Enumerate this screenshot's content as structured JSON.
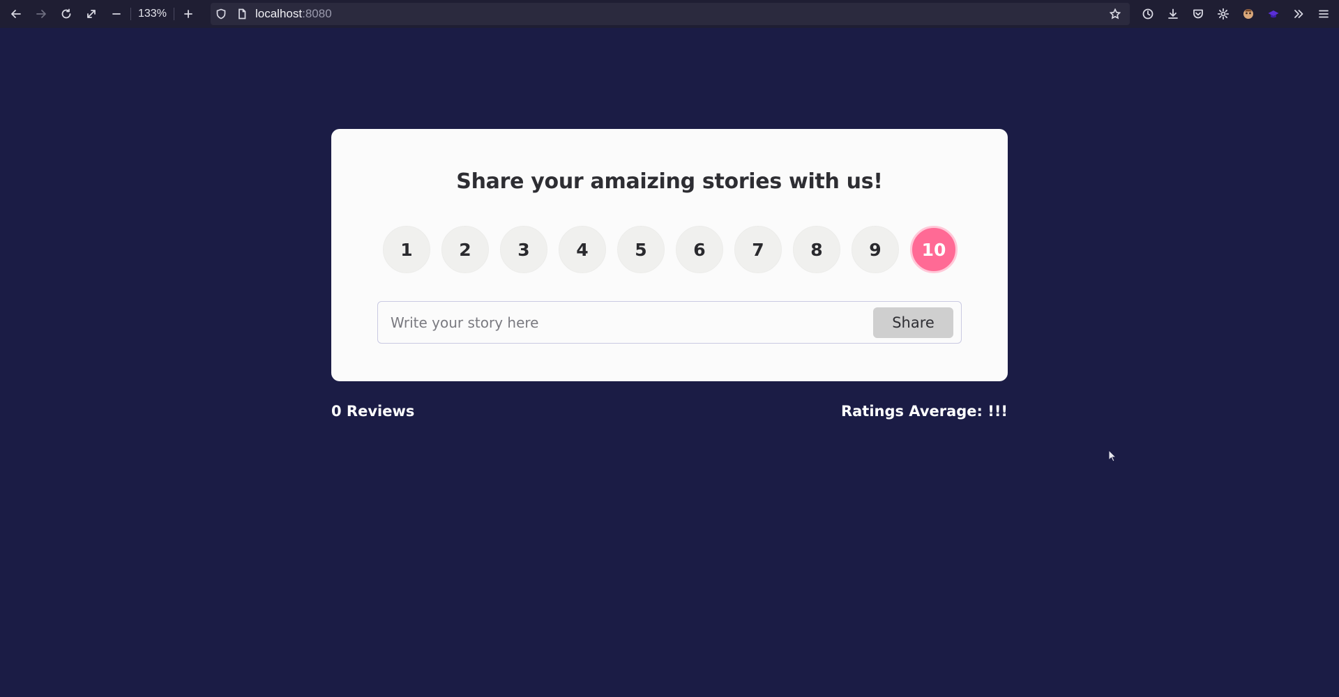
{
  "browser": {
    "zoom": "133%",
    "url_host": "localhost",
    "url_port": ":8080"
  },
  "icons": {
    "back": "arrow-left-icon",
    "forward": "arrow-right-icon",
    "reload": "reload-icon",
    "fullscreen": "expand-icon",
    "zoom_out": "minus-icon",
    "zoom_in": "plus-icon",
    "shield": "shield-icon",
    "page": "page-icon",
    "bookmark": "star-icon",
    "history": "clock-icon",
    "downloads": "download-icon",
    "pocket": "pocket-icon",
    "settings": "gear-icon",
    "extensions_overflow": "chevrons-right-icon",
    "menu": "hamburger-icon"
  },
  "card": {
    "title": "Share your amaizing stories with us!",
    "ratings": [
      "1",
      "2",
      "3",
      "4",
      "5",
      "6",
      "7",
      "8",
      "9",
      "10"
    ],
    "selected_rating": "10",
    "input_placeholder": "Write your story here",
    "input_value": "",
    "share_label": "Share"
  },
  "stats": {
    "reviews": "0 Reviews",
    "average": "Ratings Average: !!!"
  },
  "colors": {
    "page_background": "#1b1c45",
    "card_background": "#fbfbfb",
    "accent": "#ff6a95",
    "toolbar": "#1f1e33"
  }
}
